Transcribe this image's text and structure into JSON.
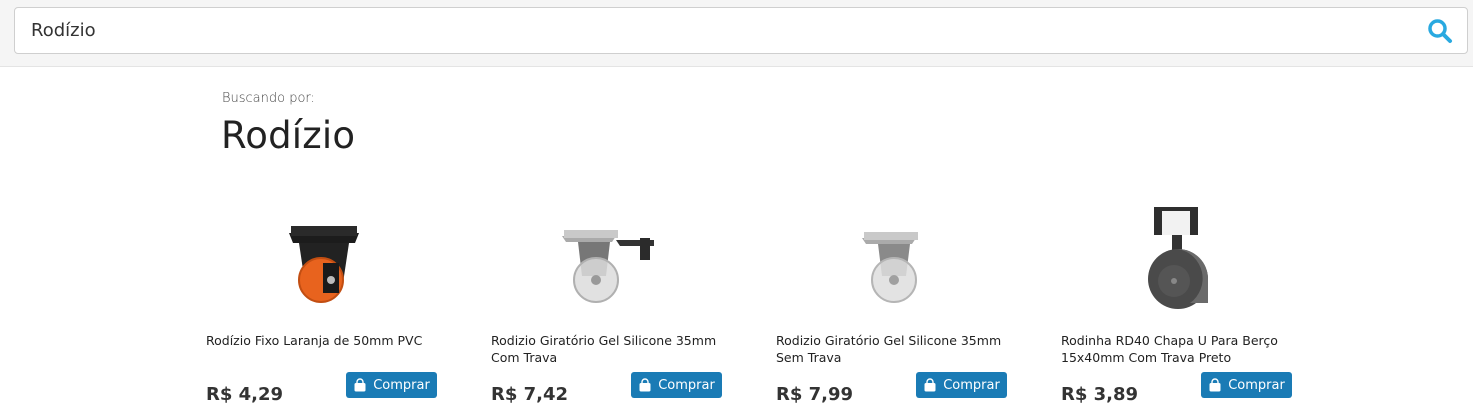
{
  "search": {
    "value": "Rodízio",
    "icon": "search-icon",
    "icon_color": "#29a9e0"
  },
  "results": {
    "label": "Buscando por:",
    "term": "Rodízio"
  },
  "products": [
    {
      "name": "Rodízio Fixo Laranja de 50mm PVC",
      "price": "R$ 4,29",
      "buy_label": "Comprar",
      "image": "orange-caster-wheel"
    },
    {
      "name": "Rodizio Giratório Gel Silicone 35mm Com Trava",
      "price": "R$ 7,42",
      "buy_label": "Comprar",
      "image": "clear-swivel-caster-with-brake"
    },
    {
      "name": "Rodizio Giratório Gel Silicone 35mm Sem Trava",
      "price": "R$ 7,99",
      "buy_label": "Comprar",
      "image": "clear-swivel-caster"
    },
    {
      "name": "Rodinha RD40 Chapa U Para Berço 15x40mm Com Trava Preto",
      "price": "R$ 3,89",
      "buy_label": "Comprar",
      "image": "gray-crib-caster-u-plate"
    }
  ],
  "colors": {
    "buy_button": "#1a7bb5"
  }
}
